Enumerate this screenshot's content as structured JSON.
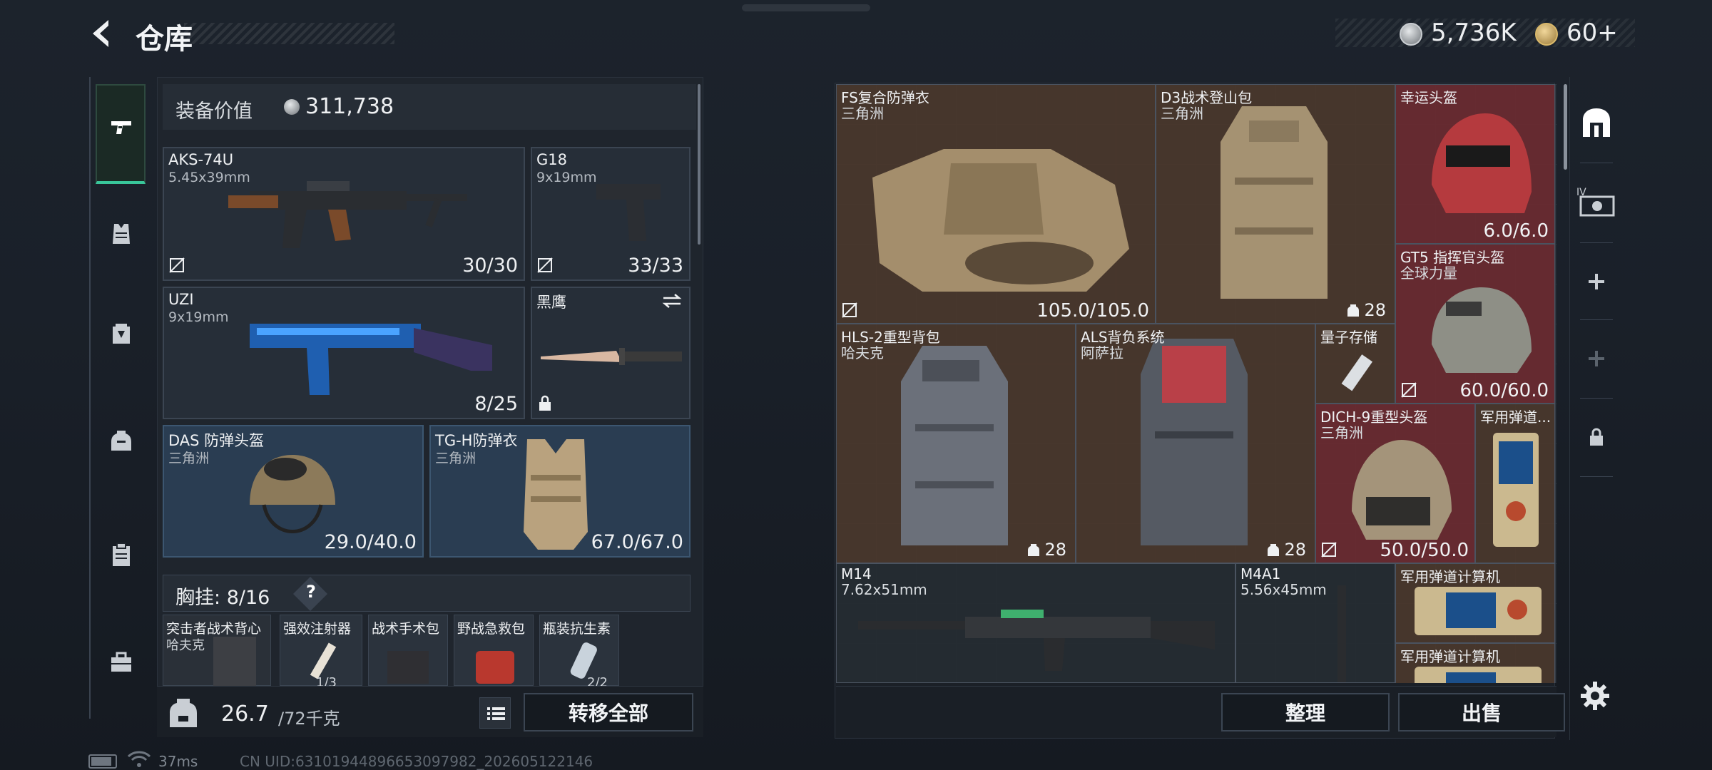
{
  "header": {
    "title": "仓库",
    "currency_silver": "5,736K",
    "currency_gold": "60+"
  },
  "left_nav": {
    "items": [
      "pistol-icon",
      "vest-icon",
      "backpack-armor-icon",
      "backpack-icon",
      "clipboard-icon",
      "toolbox-icon"
    ]
  },
  "equipment": {
    "value_label": "装备价值",
    "value_amount": "311,738",
    "slots": {
      "primary1": {
        "name": "AKS-74U",
        "caliber": "5.45x39mm",
        "ammo": "30/30"
      },
      "sidearm": {
        "name": "G18",
        "caliber": "9x19mm",
        "ammo": "33/33"
      },
      "primary2": {
        "name": "UZI",
        "caliber": "9x19mm",
        "ammo": "8/25"
      },
      "melee": {
        "name": "黑鹰"
      },
      "helmet": {
        "name": "DAS 防弹头盔",
        "maker": "三角洲",
        "durability": "29.0/40.0"
      },
      "armor": {
        "name": "TG-H防弹衣",
        "maker": "三角洲",
        "durability": "67.0/67.0"
      }
    },
    "chest_rig": {
      "label": "胸挂:",
      "count": "8/16",
      "help": "?"
    },
    "rig_items": [
      {
        "name": "突击者战术背心",
        "maker": "哈夫克"
      },
      {
        "name": "强效注射器",
        "maker": "1/3"
      },
      {
        "name": "战术手术包",
        "maker": ""
      },
      {
        "name": "野战急救包",
        "maker": ""
      },
      {
        "name": "瓶装抗生素",
        "maker": "2/2"
      }
    ]
  },
  "footer_left": {
    "weight": "26.7",
    "weight_max": "/72千克",
    "transfer_all": "转移全部"
  },
  "stash": {
    "items": [
      {
        "name": "FS复合防弹衣",
        "maker": "三角洲",
        "value": "105.0/105.0",
        "color": "brown"
      },
      {
        "name": "D3战术登山包",
        "maker": "三角洲",
        "value": "28",
        "color": "brown"
      },
      {
        "name": "幸运头盔",
        "maker": "",
        "value": "6.0/6.0",
        "color": "red"
      },
      {
        "name": "GT5 指挥官头盔",
        "maker": "全球力量",
        "value": "60.0/60.0",
        "color": "red"
      },
      {
        "name": "HLS-2重型背包",
        "maker": "哈夫克",
        "value": "28",
        "color": "brown"
      },
      {
        "name": "ALS背负系统",
        "maker": "阿萨拉",
        "value": "28",
        "color": "brown"
      },
      {
        "name": "量子存储",
        "maker": "",
        "value": "",
        "color": "brown"
      },
      {
        "name": "DICH-9重型头盔",
        "maker": "三角洲",
        "value": "50.0/50.0",
        "color": "red"
      },
      {
        "name": "军用弹道...",
        "maker": "",
        "value": "",
        "color": "brown"
      },
      {
        "name": "M14",
        "maker": "7.62x51mm",
        "value": "",
        "color": "dark"
      },
      {
        "name": "M4A1",
        "maker": "5.56x45mm",
        "value": "",
        "color": "dark"
      },
      {
        "name": "军用弹道计算机",
        "maker": "",
        "value": "",
        "color": "brown"
      },
      {
        "name": "军用弹道计算机",
        "maker": "",
        "value": "",
        "color": "brown"
      }
    ]
  },
  "footer_right": {
    "sort": "整理",
    "sell": "出售"
  },
  "status": {
    "ping": "37ms",
    "uid": "CN UID:63101944896653097982_202605122146"
  },
  "colors": {
    "accent_green": "#39c69a",
    "slot_blue": "#2a3d52",
    "cell_brown": "#4a372b",
    "cell_red": "#692a30"
  }
}
